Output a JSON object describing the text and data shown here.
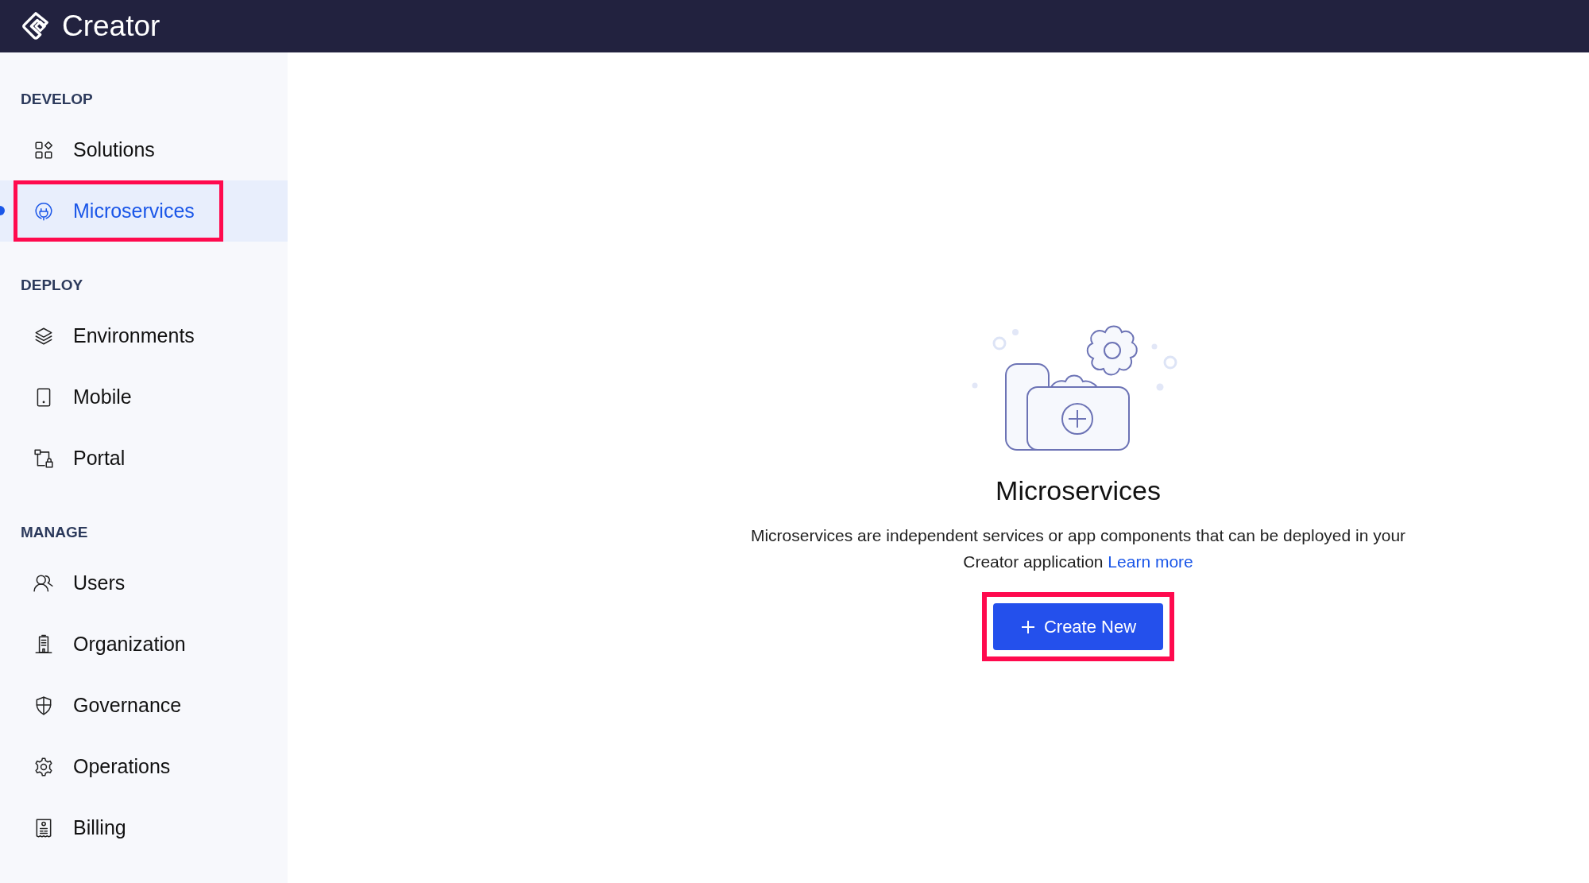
{
  "app": {
    "title": "Creator"
  },
  "sidebar": {
    "sections": [
      {
        "label": "DEVELOP",
        "items": [
          {
            "label": "Solutions",
            "kind": "grid",
            "selected": false,
            "highlighted": false
          },
          {
            "label": "Microservices",
            "kind": "plug",
            "selected": true,
            "highlighted": true
          }
        ]
      },
      {
        "label": "DEPLOY",
        "items": [
          {
            "label": "Environments",
            "kind": "layers",
            "selected": false,
            "highlighted": false
          },
          {
            "label": "Mobile",
            "kind": "phone",
            "selected": false,
            "highlighted": false
          },
          {
            "label": "Portal",
            "kind": "portal",
            "selected": false,
            "highlighted": false
          }
        ]
      },
      {
        "label": "MANAGE",
        "items": [
          {
            "label": "Users",
            "kind": "users",
            "selected": false,
            "highlighted": false
          },
          {
            "label": "Organization",
            "kind": "building",
            "selected": false,
            "highlighted": false
          },
          {
            "label": "Governance",
            "kind": "shield",
            "selected": false,
            "highlighted": false
          },
          {
            "label": "Operations",
            "kind": "gear",
            "selected": false,
            "highlighted": false
          },
          {
            "label": "Billing",
            "kind": "receipt",
            "selected": false,
            "highlighted": false
          }
        ]
      }
    ]
  },
  "empty_state": {
    "title": "Microservices",
    "description": "Microservices are independent services or app components that can be deployed in your Creator application",
    "link": "Learn more",
    "button": {
      "label": "Create New",
      "highlighted": true
    }
  }
}
